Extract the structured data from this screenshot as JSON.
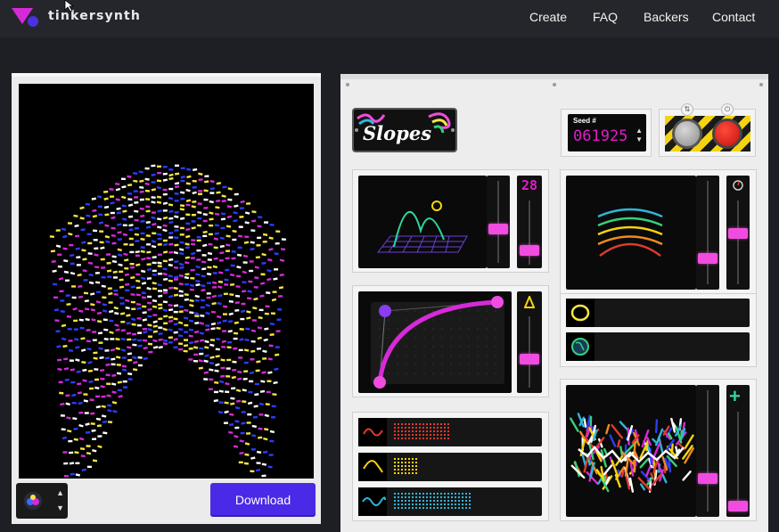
{
  "header": {
    "brand": "tinkersynth",
    "nav": [
      "Create",
      "FAQ",
      "Backers",
      "Contact"
    ]
  },
  "preview": {
    "download_label": "Download",
    "colors": [
      "#2c3cff",
      "#f5e642",
      "#d62ad8",
      "#ffffff"
    ]
  },
  "machine": {
    "title": "Slopes",
    "seed": {
      "label": "Seed #",
      "value": "061925"
    },
    "buttons": {
      "randomize_icon": "shuffle-icon",
      "power_icon": "power-icon"
    },
    "peaks": {
      "led_value": "28",
      "slider_level": 0.42,
      "side_slider_level": 0.27
    },
    "curve": {
      "slider_level": 0.42
    },
    "lines": {
      "slider_level": 0.25,
      "side_slider_level": 0.65
    },
    "waveforms": [
      {
        "icon": "sine-wave-icon",
        "color": "#e03a2f"
      },
      {
        "icon": "bump-wave-icon",
        "color": "#f5d40f"
      },
      {
        "icon": "wave-icon",
        "color": "#2fb6d8"
      }
    ],
    "toggles": [
      {
        "icon": "circle-icon",
        "color": "#f5e642"
      },
      {
        "icon": "globe-icon",
        "color": "#38d07a"
      }
    ],
    "noise": {
      "slider_level": 0.27,
      "side_slider_level": 0.0
    },
    "accent": "#f04ce0",
    "led_color": "#e01cc8"
  }
}
